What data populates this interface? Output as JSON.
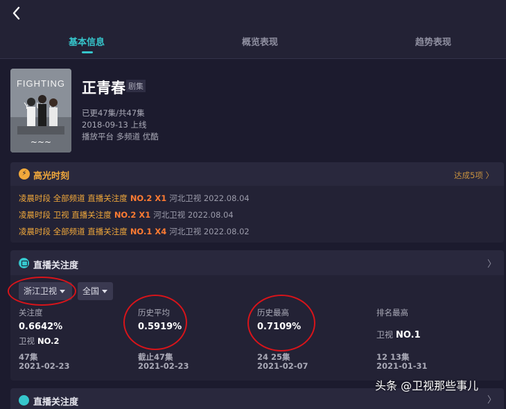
{
  "tabs": [
    {
      "label": "基本信息",
      "active": true
    },
    {
      "label": "概览表现",
      "active": false
    },
    {
      "label": "趋势表现",
      "active": false
    }
  ],
  "show": {
    "title": "正青春",
    "type": "剧集",
    "episodes": "已更47集/共47集",
    "release": "2018-09-13 上线",
    "platform": "播放平台 多频道 优酷",
    "poster_text": "FIGHTING YOUTH"
  },
  "highlights": {
    "title": "高光时刻",
    "more": "达成5项 〉",
    "items": [
      {
        "segment": "凌晨时段 全部频道 直播关注度",
        "rank": "NO.2 X1",
        "source": "河北卫视 2022.08.04"
      },
      {
        "segment": "凌晨时段 卫视 直播关注度",
        "rank": "NO.2 X1",
        "source": "河北卫视 2022.08.04"
      },
      {
        "segment": "凌晨时段 全部频道 直播关注度",
        "rank": "NO.1 X4",
        "source": "河北卫视 2022.08.02"
      }
    ]
  },
  "attention": {
    "title": "直播关注度",
    "chevron": "〉",
    "channel_select": "浙江卫视",
    "region_select": "全国",
    "stats": [
      {
        "label": "关注度",
        "value": "0.6642%",
        "sub_label": "卫视",
        "sub_value": "NO.2",
        "foot1": "47集",
        "foot2": "2021-02-23"
      },
      {
        "label": "历史平均",
        "value": "0.5919%",
        "sub_label": "",
        "sub_value": "",
        "foot1": "截止47集",
        "foot2": "2021-02-23"
      },
      {
        "label": "历史最高",
        "value": "0.7109%",
        "sub_label": "",
        "sub_value": "",
        "foot1": "24 25集",
        "foot2": "2021-02-07"
      },
      {
        "label": "排名最高",
        "value": "",
        "sub_label": "卫视",
        "sub_value": "NO.1",
        "foot1": "12 13集",
        "foot2": "2021-01-31"
      }
    ]
  },
  "attention2": {
    "title": "直播关注度",
    "chevron": "〉"
  },
  "watermark": "头条 @卫视那些事儿",
  "colors": {
    "accent": "#36c6cc",
    "highlight": "#f2a93b",
    "rank": "#ff7b32",
    "annotation_ring": "#d8141a",
    "background": "#1c1b2e"
  }
}
